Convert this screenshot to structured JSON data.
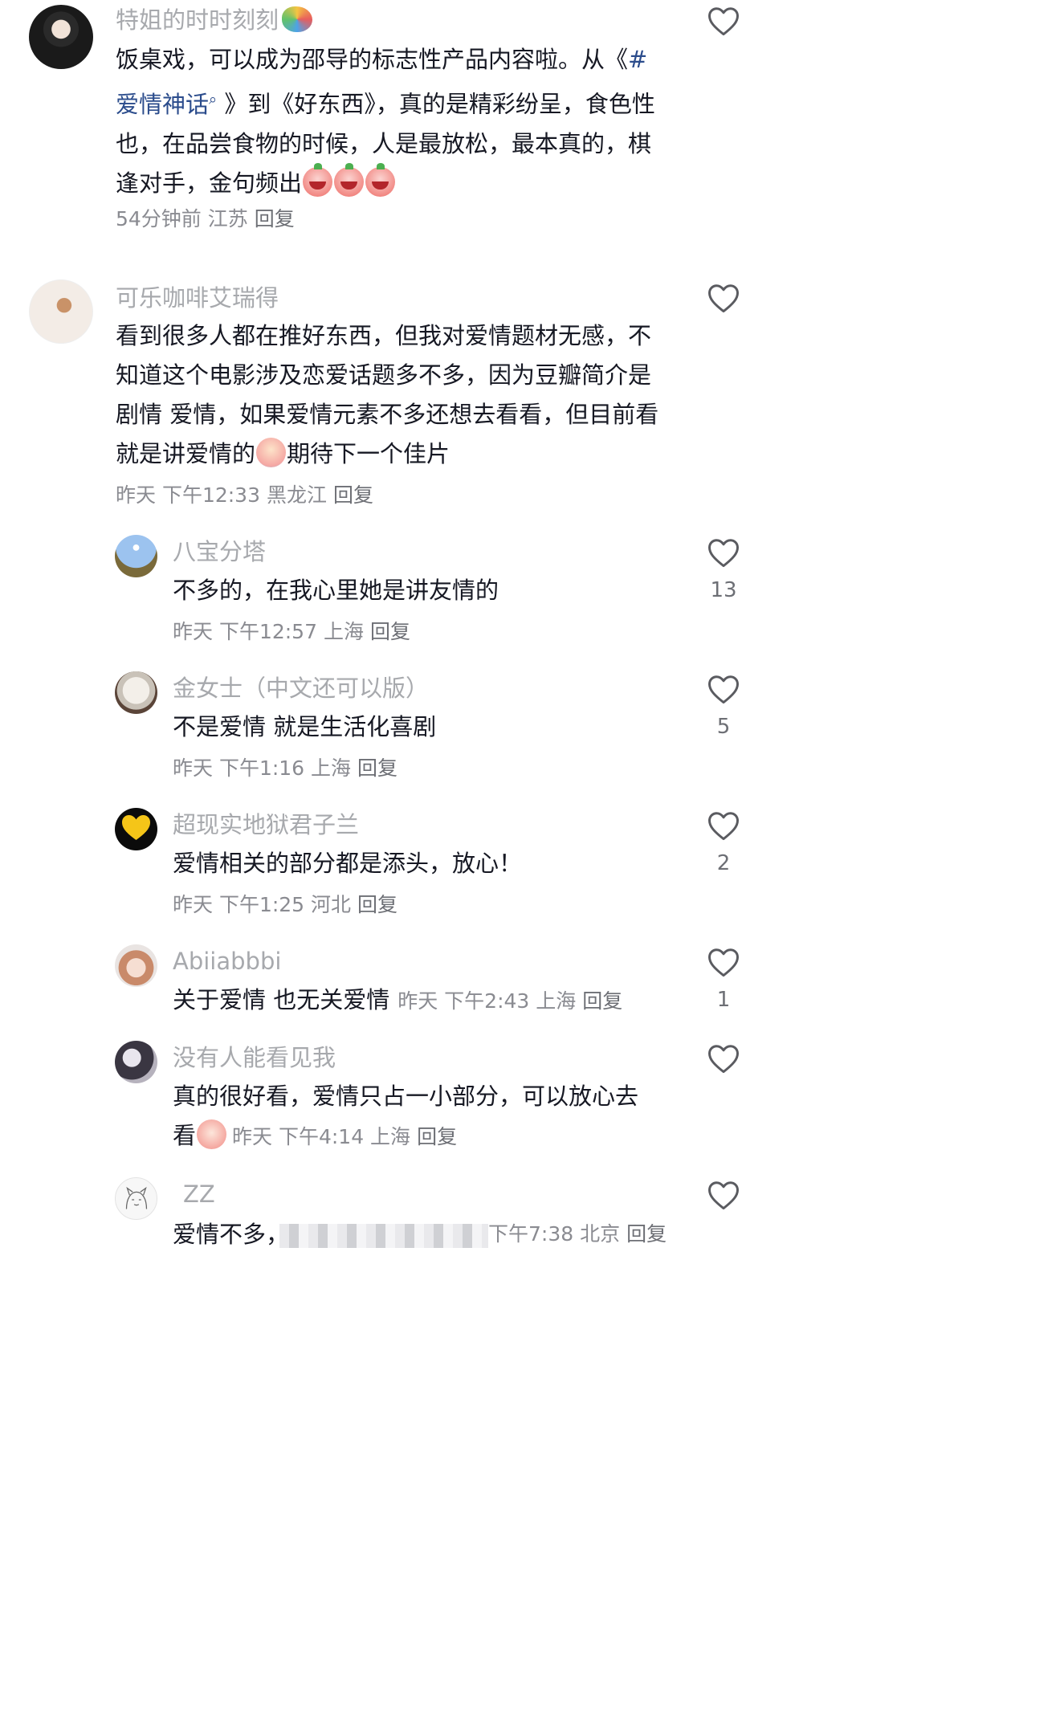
{
  "comments": [
    {
      "username": "特姐的时时刻刻",
      "emoji": "palette-emoji",
      "content_prefix": "饭桌戏，可以成为邵导的标志性产品内容啦。从《",
      "hashtag": "# 爱情神话",
      "content_suffix": "》到《好东西》，真的是精彩纷呈，食色性也，在品尝食物的时候，人是最放松，最本真的，棋逢对手，金句频出",
      "meta": "54分钟前 江苏",
      "reply": "回复"
    },
    {
      "username": "可乐咖啡艾瑞得",
      "content_prefix": "看到很多人都在推好东西，但我对爱情题材无感，不知道这个电影涉及恋爱话题多不多，因为豆瓣简介是剧情 爱情，如果爱情元素不多还想去看看，但目前看就是讲爱情的",
      "content_suffix": "期待下一个佳片",
      "meta": "昨天 下午12:33 黑龙江",
      "reply": "回复"
    }
  ],
  "replies": [
    {
      "username": "八宝分塔",
      "content": "不多的，在我心里她是讲友情的",
      "meta": "昨天 下午12:57 上海",
      "reply": "回复",
      "likes": "13"
    },
    {
      "username": "金女士（中文还可以版）",
      "content": "不是爱情 就是生活化喜剧",
      "meta": "昨天 下午1:16 上海",
      "reply": "回复",
      "likes": "5"
    },
    {
      "username": "超现实地狱君子兰",
      "content": "爱情相关的部分都是添头，放心！",
      "meta": "昨天 下午1:25 河北",
      "reply": "回复",
      "likes": "2"
    },
    {
      "username": "Abiiabbbi",
      "content": "关于爱情 也无关爱情",
      "meta": "昨天 下午2:43 上海",
      "reply": "回复",
      "likes": "1"
    },
    {
      "username": "没有人能看见我",
      "content": "真的很好看，爱情只占一小部分，可以放心去",
      "content_line2": "看",
      "meta": "昨天 下午4:14 上海",
      "reply": "回复"
    },
    {
      "username": "ZZ",
      "content": "爱情不多，",
      "meta": "下午7:38 北京",
      "reply": "回复"
    }
  ],
  "colors": {
    "name": "#a7a9ad",
    "text": "#161823",
    "meta": "#8a8b91",
    "hashtag": "#2b4c8c"
  },
  "icons": {
    "like": "heart-outline-icon",
    "hashtag_search": "search-icon"
  }
}
